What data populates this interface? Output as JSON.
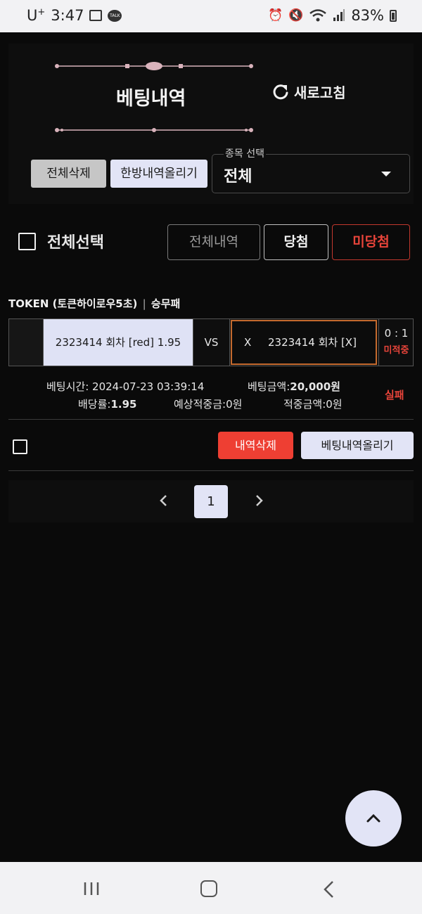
{
  "status_bar": {
    "carrier": "U",
    "carrier_sup": "+",
    "time": "3:47",
    "talk_icon_text": "TALK",
    "battery": "83%"
  },
  "header": {
    "title": "베팅내역",
    "refresh_label": "새로고침"
  },
  "actions": {
    "delete_all": "전체삭제",
    "upload_all": "한방내역올리기"
  },
  "select": {
    "legend": "종목 선택",
    "value": "전체"
  },
  "filters": {
    "select_all": "전체선택",
    "all_history": "전체내역",
    "win": "당첨",
    "not_won": "미당첨"
  },
  "bet": {
    "game": "TOKEN (토큰하이로우5초)",
    "separator": "|",
    "market": "승무패",
    "pick": "2323414 회차 [red] 1.95",
    "vs": "VS",
    "other_mark": "X",
    "other": "2323414 회차 [X]",
    "score": "0 : 1",
    "score_status": "미적중",
    "bet_time_label": "베팅시간:",
    "bet_time": "2024-07-23 03:39:14",
    "bet_amount_label": "베팅금액:",
    "bet_amount": "20,000원",
    "odds_label": "배당률:",
    "odds": "1.95",
    "expected_label": "예상적중금:",
    "expected": "0원",
    "won_label": "적중금액:",
    "won": "0원",
    "result": "실패",
    "delete_label": "내역삭제",
    "upload_label": "베팅내역올리기"
  },
  "pagination": {
    "current": "1"
  },
  "icons": {
    "refresh": "refresh-icon",
    "caret": "caret-down-icon",
    "prev": "chevron-left-icon",
    "next": "chevron-right-icon",
    "top": "chevron-up-icon"
  },
  "colors": {
    "accent_red": "#e8443a",
    "pick_bg": "#dfe2f5",
    "highlight_border": "#c46a2e"
  }
}
